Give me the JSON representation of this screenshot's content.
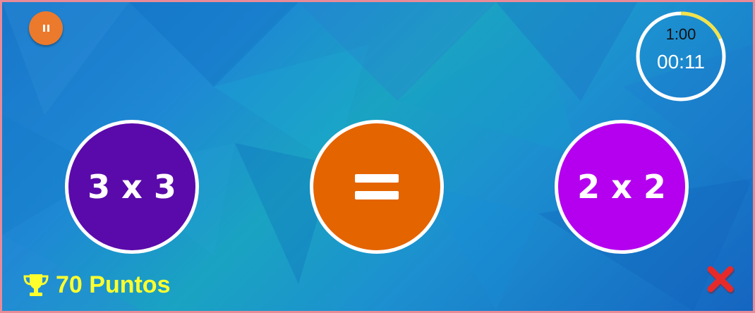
{
  "game": {
    "controls": {
      "pause_icon": "pause-icon",
      "close_icon": "close-x-icon"
    },
    "timer": {
      "limit": "1:00",
      "elapsed": "00:11",
      "progress": 0.183
    },
    "equation": {
      "left_expression": "3 x 3",
      "comparator_symbol": "=",
      "right_expression": "2 x 2"
    },
    "score": {
      "label": "70 Puntos",
      "icon": "trophy-icon"
    }
  },
  "colors": {
    "background": "#1a85d0",
    "pause_button": "#ec7a2c",
    "left_bubble": "#5a0aaa",
    "comparator_bubble": "#e46400",
    "right_bubble": "#b400ee",
    "timer_progress": "#f2e24a",
    "score_text": "#ffff2e",
    "close_icon": "#e62a2a",
    "frame_border": "#e98a98"
  }
}
